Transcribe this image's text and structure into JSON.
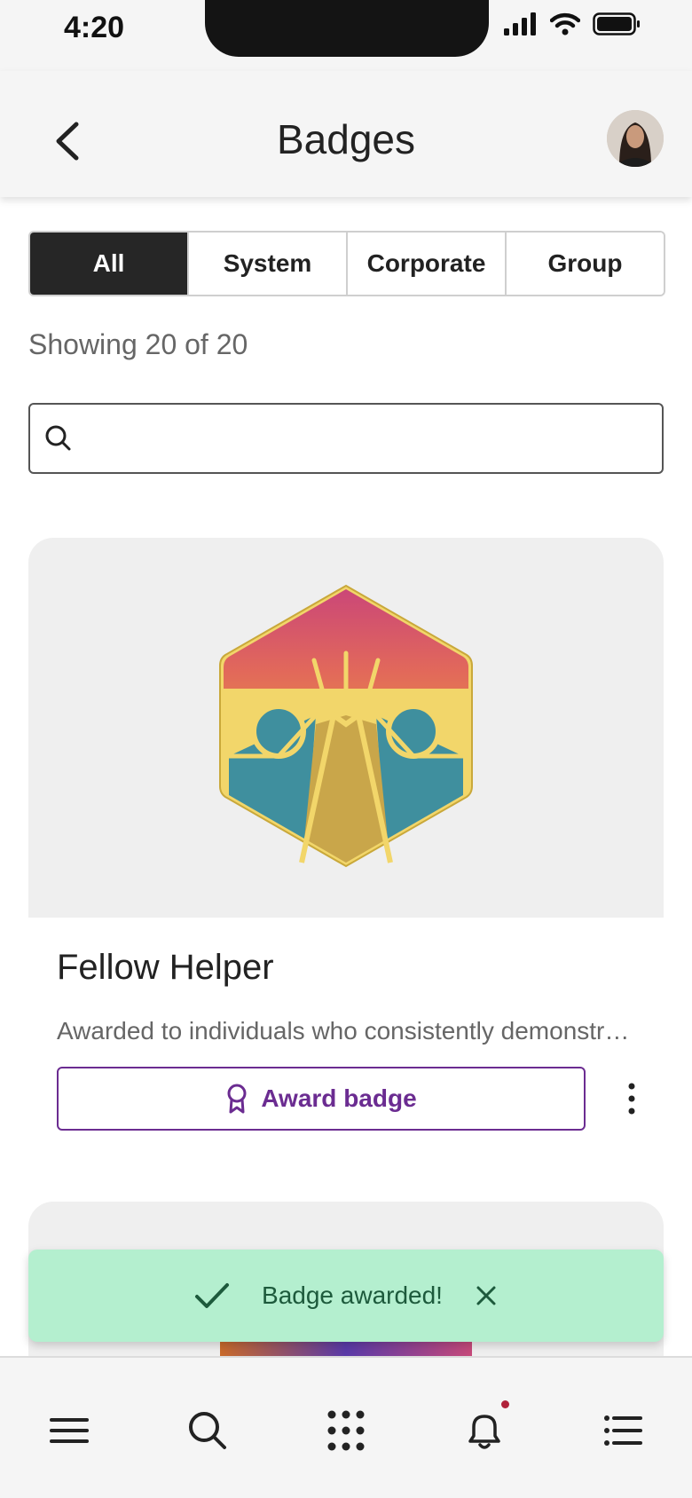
{
  "status_bar": {
    "time": "4:20"
  },
  "header": {
    "title": "Badges",
    "back_icon": "chevron-left-icon",
    "avatar_icon": "user-avatar"
  },
  "tabs": [
    {
      "label": "All",
      "active": true
    },
    {
      "label": "System",
      "active": false
    },
    {
      "label": "Corporate",
      "active": false
    },
    {
      "label": "Group",
      "active": false
    }
  ],
  "results": {
    "showing_text": "Showing 20 of 20"
  },
  "search": {
    "placeholder": "",
    "value": ""
  },
  "badge_card": {
    "title": "Fellow Helper",
    "description": "Awarded to individuals who consistently demonstrate a willingness to help others.",
    "award_label": "Award badge",
    "award_icon": "ribbon-award-icon",
    "more_icon": "more-vertical-icon"
  },
  "toast": {
    "message": "Badge awarded!",
    "icon": "check-icon",
    "close_icon": "close-icon"
  },
  "bottom_nav": [
    {
      "icon": "menu-icon"
    },
    {
      "icon": "search-icon"
    },
    {
      "icon": "apps-grid-icon"
    },
    {
      "icon": "bell-icon",
      "has_notification": true
    },
    {
      "icon": "list-icon"
    }
  ],
  "colors": {
    "accent": "#6b2c91",
    "toast_bg": "#b4efcf",
    "active_tab": "#262626",
    "notification_dot": "#b0223a"
  }
}
